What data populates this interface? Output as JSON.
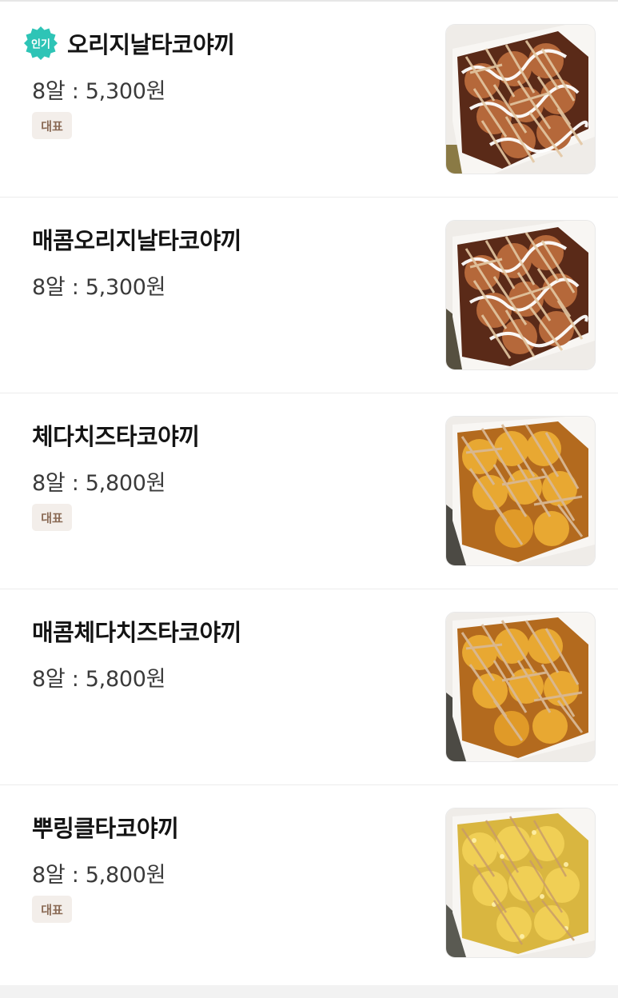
{
  "badge": {
    "popular_label": "인기",
    "popular_color": "#2ec4b6"
  },
  "tag": {
    "color_bg": "#f3eeea",
    "color_text": "#8a6a55"
  },
  "menu": {
    "items": [
      {
        "name": "오리지날타코야끼",
        "price": "8알 : 5,300원",
        "popular": true,
        "tag": "대표",
        "thumb_sauce": "#5a2a18",
        "thumb_ball": "#b5683a"
      },
      {
        "name": "매콤오리지날타코야끼",
        "price": "8알 : 5,300원",
        "popular": false,
        "tag": "",
        "thumb_sauce": "#5a2a18",
        "thumb_ball": "#b5683a"
      },
      {
        "name": "체다치즈타코야끼",
        "price": "8알 : 5,800원",
        "popular": false,
        "tag": "대표",
        "thumb_sauce": "#b36a1e",
        "thumb_ball": "#e8a832"
      },
      {
        "name": "매콤체다치즈타코야끼",
        "price": "8알 : 5,800원",
        "popular": false,
        "tag": "",
        "thumb_sauce": "#b36a1e",
        "thumb_ball": "#e8a832"
      },
      {
        "name": "뿌링클타코야끼",
        "price": "8알 : 5,800원",
        "popular": false,
        "tag": "대표",
        "thumb_sauce": "#d9b640",
        "thumb_ball": "#f0cf55"
      }
    ]
  }
}
